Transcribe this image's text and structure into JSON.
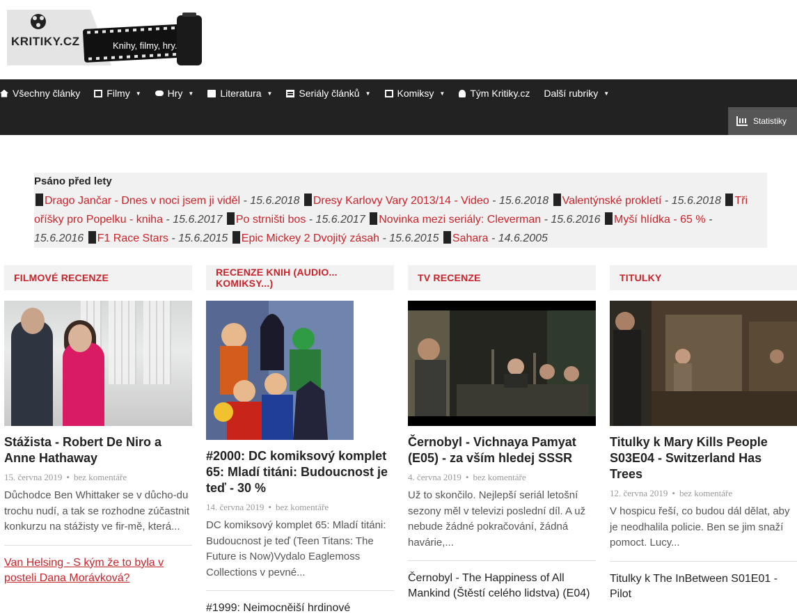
{
  "logo": {
    "brand": "KRITIKY.CZ",
    "tagline": "Knihy, filmy, hry.."
  },
  "nav": {
    "items": [
      {
        "label": "Všechny články",
        "icon": "home-icon",
        "dropdown": false
      },
      {
        "label": "Filmy",
        "icon": "film-icon",
        "dropdown": true
      },
      {
        "label": "Hry",
        "icon": "gamepad-icon",
        "dropdown": true
      },
      {
        "label": "Literatura",
        "icon": "book-icon",
        "dropdown": true
      },
      {
        "label": "Seriály článků",
        "icon": "tv-icon",
        "dropdown": true
      },
      {
        "label": "Komiksy",
        "icon": "image-icon",
        "dropdown": true
      },
      {
        "label": "Tým Kritiky.cz",
        "icon": "user-icon",
        "dropdown": false
      },
      {
        "label": "Další rubriky",
        "icon": "",
        "dropdown": true
      }
    ],
    "stats_label": "Statistiky",
    "caret": "▼"
  },
  "past": {
    "title": "Psáno před lety",
    "items": [
      {
        "title": "Drago Jančar - Dnes v noci jsem ji viděl",
        "date": " - 15.6.2018"
      },
      {
        "title": "Dresy Karlovy Vary 2013/14 - Video",
        "date": " - 15.6.2018"
      },
      {
        "title": "Valentýnské prokletí",
        "date": " - 15.6.2018"
      },
      {
        "title": "Tři oříšky pro Popelku - kniha",
        "date": " - 15.6.2017"
      },
      {
        "title": "Po strništi bos",
        "date": " - 15.6.2017"
      },
      {
        "title": "Novinka mezi seriály: Cleverman",
        "date": " - 15.6.2016"
      },
      {
        "title": "Myší hlídka - 65 %",
        "date": " - 15.6.2016"
      },
      {
        "title": "F1 Race Stars",
        "date": " - 15.6.2015"
      },
      {
        "title": "Epic Mickey 2 Dvojitý zásah",
        "date": " - 15.6.2015"
      },
      {
        "title": "Sahara",
        "date": " - 14.6.2005"
      }
    ]
  },
  "columns": [
    {
      "heading": "FILMOVÉ RECENZE",
      "title": "Stážista - Robert De Niro a Anne Hathaway",
      "date": "15. června 2019",
      "comments": "bez komentáře",
      "excerpt": "Důchodce Ben Whittaker se v důcho-du trochu nudí, a tak se rozhodne zúčastnit konkurzu na stážisty ve fir-mě, která...",
      "more": "Van Helsing - S kým že to byla v posteli Dana Morávková?"
    },
    {
      "heading": "RECENZE KNIH (AUDIO... KOMIKSY...)",
      "title": "#2000: DC komiksový komplet 65: Mladí titáni: Budoucnost je teď - 30 %",
      "date": "14. června 2019",
      "comments": "bez komentáře",
      "excerpt": "DC komiksový komplet 65: Mladí titáni: Budoucnost je teď (Teen Titans: The Future is Now)Vydalo Eaglemoss Collections v pevné...",
      "more": "#1999: Neimocněiší hrdinové"
    },
    {
      "heading": "TV RECENZE",
      "title": "Černobyl - Vichnaya Pamyat (E05) - za vším hledej SSSR",
      "date": "4. června 2019",
      "comments": "bez komentáře",
      "excerpt": "Už to skončilo. Nejlepší seriál letošní sezony měl v televizi poslední díl. A už nebude žádné pokračování, žádná havárie,...",
      "more": "Černobyl - The Happiness of All Mankind (Štěstí celého lidstva) (E04)"
    },
    {
      "heading": "TITULKY",
      "title": "Titulky k Mary Kills People S03E04 - Switzerland Has Trees",
      "date": "12. června 2019",
      "comments": "bez komentáře",
      "excerpt": "V hospicu řeší, co budou dál dělat, aby je neodhalila policie. Ben se jim snaží pomoct. Lucy...",
      "more": "Titulky k The InBetween S01E01 - Pilot"
    }
  ],
  "meta_sep": "•"
}
